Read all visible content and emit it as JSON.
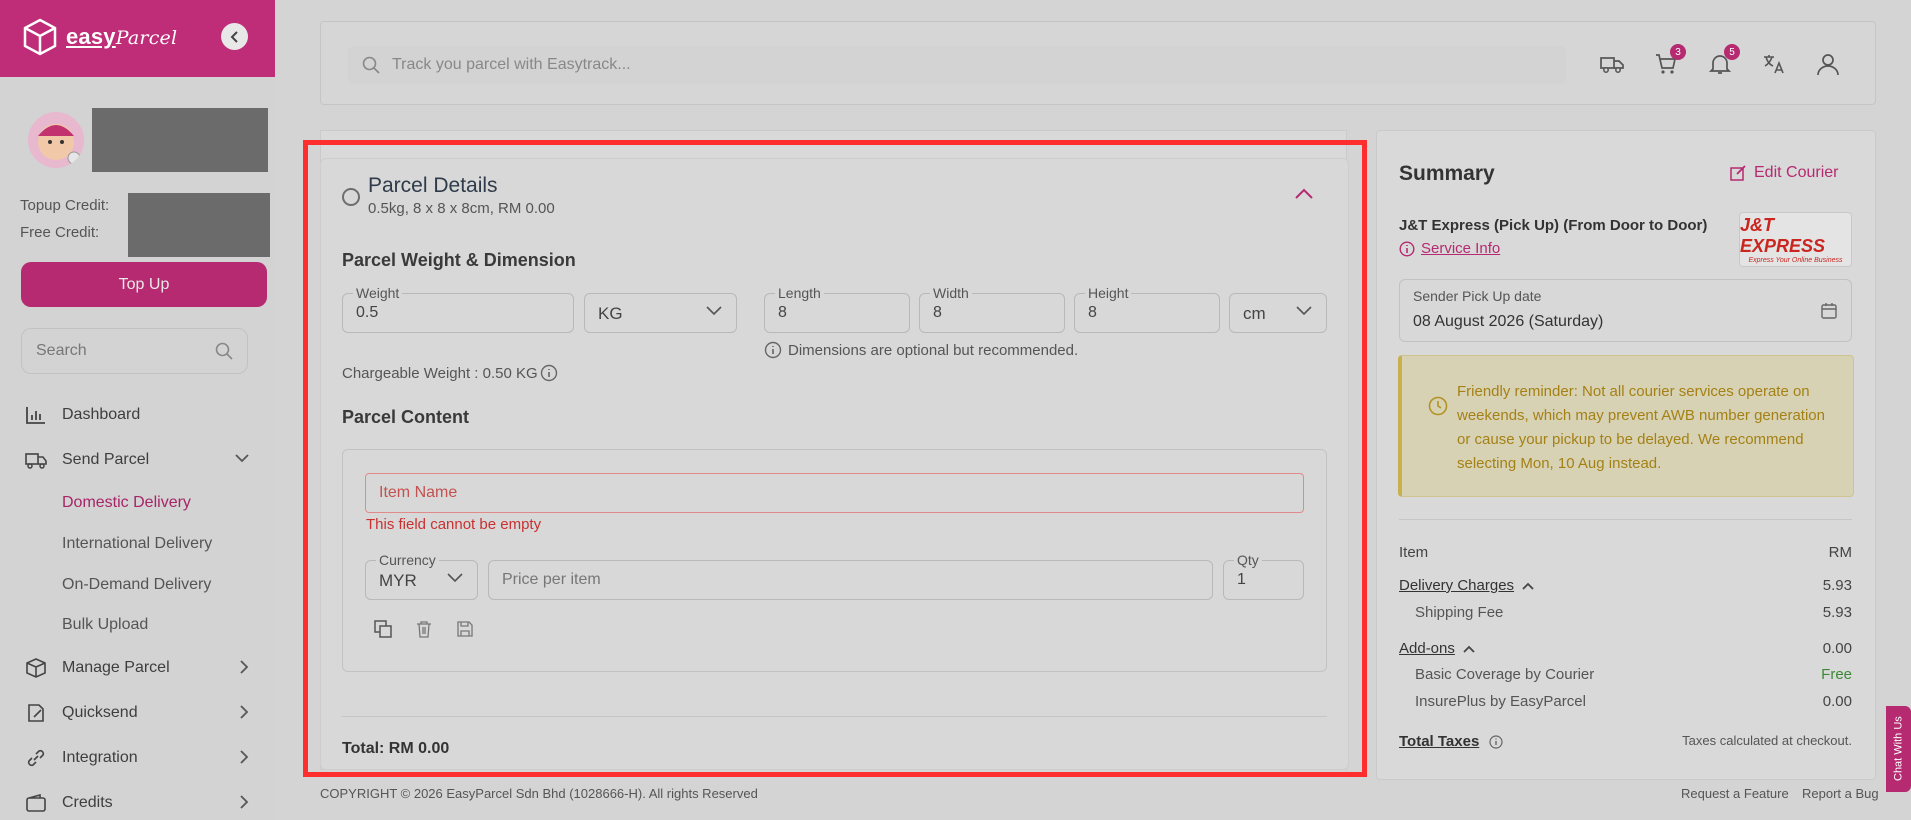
{
  "brand": {
    "name": "easy",
    "name_script": "Parcel"
  },
  "sidebar": {
    "topup_credit_label": "Topup Credit:",
    "free_credit_label": "Free Credit:",
    "topup_button": "Top Up",
    "search_placeholder": "Search",
    "nav": [
      {
        "label": "Dashboard",
        "icon": "chart-icon"
      },
      {
        "label": "Send Parcel",
        "icon": "truck-icon",
        "expanded": true
      },
      {
        "label": "Manage Parcel",
        "icon": "box-icon"
      },
      {
        "label": "Quicksend",
        "icon": "quicksend-icon"
      },
      {
        "label": "Integration",
        "icon": "link-icon"
      },
      {
        "label": "Credits",
        "icon": "wallet-icon"
      }
    ],
    "sub_items": [
      "Domestic Delivery",
      "International Delivery",
      "On-Demand Delivery",
      "Bulk Upload"
    ]
  },
  "topbar": {
    "track_placeholder": "Track you parcel with Easytrack...",
    "cart_count": "3",
    "notification_count": "5"
  },
  "parcel": {
    "title": "Parcel Details",
    "subtitle": "0.5kg, 8 x 8 x 8cm, RM 0.00",
    "weight_dim_heading": "Parcel Weight & Dimension",
    "weight_label": "Weight",
    "weight_value": "0.5",
    "weight_unit": "KG",
    "length_label": "Length",
    "length_value": "8",
    "width_label": "Width",
    "width_value": "8",
    "height_label": "Height",
    "height_value": "8",
    "dim_unit": "cm",
    "dim_hint": "Dimensions are optional but recommended.",
    "chargeable_weight": "Chargeable Weight : 0.50 KG",
    "content_heading": "Parcel Content",
    "item_name_placeholder": "Item Name",
    "error_text": "This field cannot be empty",
    "currency_label": "Currency",
    "currency_value": "MYR",
    "price_placeholder": "Price per item",
    "qty_label": "Qty",
    "qty_value": "1",
    "total": "Total: RM 0.00"
  },
  "summary": {
    "title": "Summary",
    "edit_courier": "Edit Courier",
    "courier_name": "J&T Express (Pick Up) (From Door to Door)",
    "service_info": "Service Info",
    "logo_text": "J&T EXPRESS",
    "logo_tagline": "Express Your Online Business",
    "pickup_label": "Sender Pick Up date",
    "pickup_value": "08 August 2026 (Saturday)",
    "reminder": "Friendly reminder: Not all courier services operate on weekends, which may prevent AWB number generation or cause your pickup to be delayed. We recommend selecting Mon, 10 Aug instead.",
    "item_label": "Item",
    "currency": "RM",
    "delivery_charges": "Delivery Charges",
    "delivery_value": "5.93",
    "shipping_fee": "Shipping Fee",
    "shipping_value": "5.93",
    "addons": "Add-ons",
    "addons_value": "0.00",
    "basic_coverage": "Basic Coverage by Courier",
    "basic_value": "Free",
    "insureplus": "InsurePlus by EasyParcel",
    "insureplus_value": "0.00",
    "total_taxes": "Total Taxes",
    "taxes_note": "Taxes calculated at checkout."
  },
  "footer": {
    "copyright": "COPYRIGHT © 2026 EasyParcel Sdn Bhd (1028666-H). All rights Reserved",
    "request_feature": "Request a Feature",
    "report_bug": "Report a Bug"
  },
  "chat_tab": "Chat With Us",
  "colors": {
    "brand": "#bf2c78",
    "error": "#c93131",
    "highlight": "#ff2e2e"
  }
}
